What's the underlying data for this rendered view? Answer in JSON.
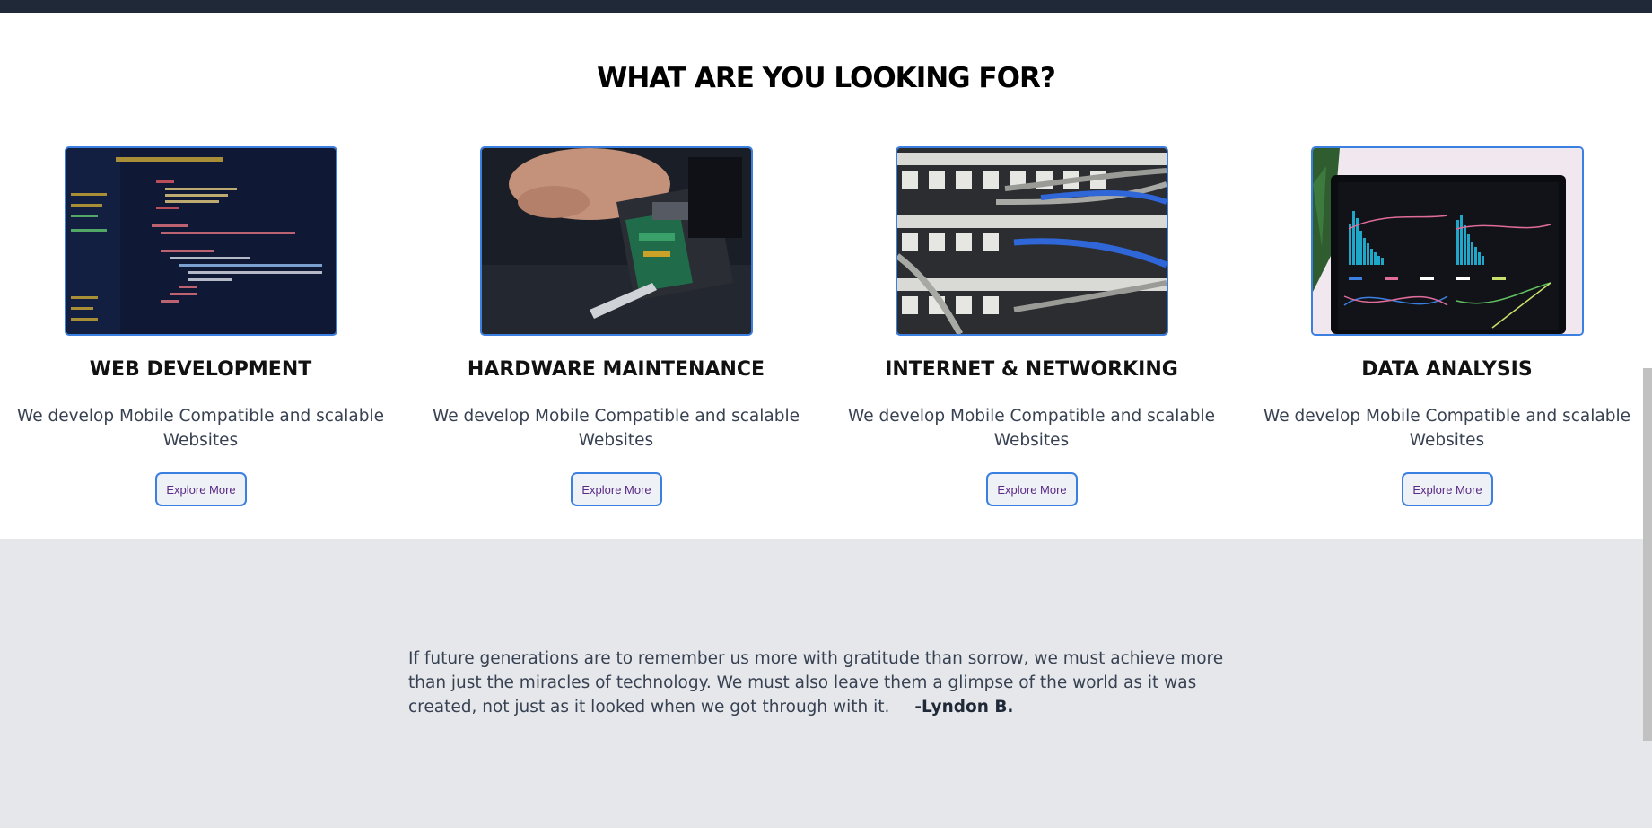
{
  "heading": "WHAT ARE YOU LOOKING FOR?",
  "services": [
    {
      "title": "WEB DEVELOPMENT",
      "description": "We develop Mobile Compatible and scalable Websites",
      "button": "Explore More"
    },
    {
      "title": "HARDWARE MAINTENANCE",
      "description": "We develop Mobile Compatible and scalable Websites",
      "button": "Explore More"
    },
    {
      "title": "INTERNET & NETWORKING",
      "description": "We develop Mobile Compatible and scalable Websites",
      "button": "Explore More"
    },
    {
      "title": "DATA ANALYSIS",
      "description": "We develop Mobile Compatible and scalable Websites",
      "button": "Explore More"
    }
  ],
  "quote": {
    "text": "If future generations are to remember us more with gratitude than sorrow, we must achieve more than just the miracles of technology. We must also leave them a glimpse of the world as it was created, not just as it looked when we got through with it.",
    "author": "-Lyndon B."
  },
  "colors": {
    "header_bar": "#1f2937",
    "card_border": "#3b7fe0",
    "button_text": "#5b2a86",
    "quote_bg": "#e5e7eb"
  }
}
